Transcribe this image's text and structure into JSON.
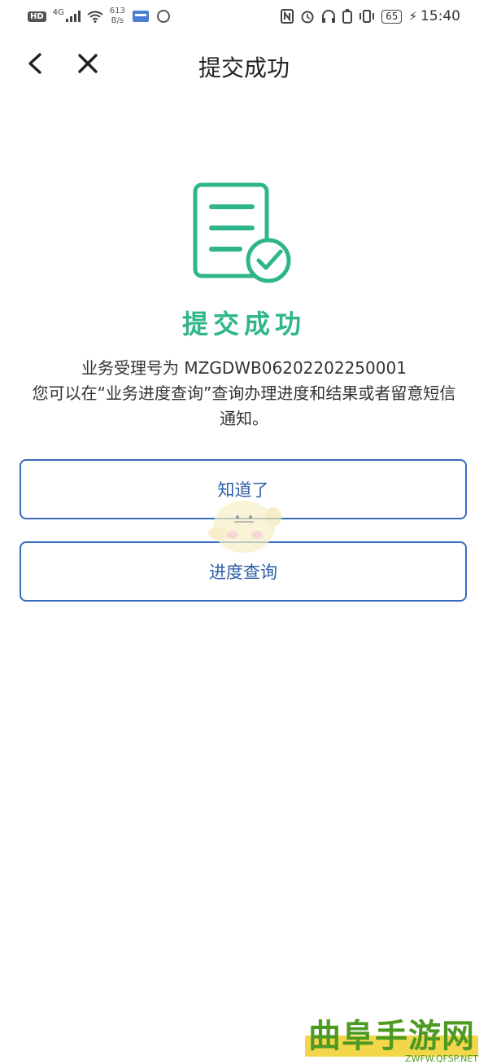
{
  "status_bar": {
    "hd": "HD",
    "network": "4G",
    "speed_value": "613",
    "speed_unit": "B/s",
    "battery": "65",
    "time": "15:40"
  },
  "nav": {
    "title": "提交成功"
  },
  "result": {
    "title": "提交成功",
    "line1": "业务受理号为 MZGDWB06202202250001",
    "line2": "您可以在“业务进度查询”查询办理进度和结果或者留意短信通知。"
  },
  "buttons": {
    "ok_label": "知道了",
    "progress_label": "进度查询"
  },
  "watermark": {
    "name": "曲阜手游网",
    "url": "ZWFW.QFSP.NET"
  },
  "colors": {
    "success_green": "#2fb58b",
    "button_blue": "#3a6bbb"
  }
}
